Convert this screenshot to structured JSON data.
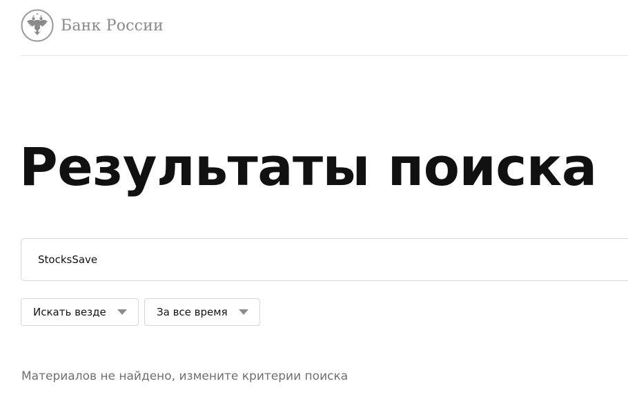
{
  "header": {
    "logo_text": "Банк России",
    "emblem_icon": "double-headed-eagle-icon"
  },
  "main": {
    "title": "Результаты поиска",
    "search": {
      "value": "StocksSave",
      "placeholder": ""
    },
    "filters": {
      "scope": {
        "selected": "Искать везде",
        "icon": "chevron-down-icon"
      },
      "period": {
        "selected": "За все время",
        "icon": "chevron-down-icon"
      }
    },
    "empty_message": "Материалов не найдено, измените критерии поиска"
  },
  "colors": {
    "logo_gray": "#8a8a8a",
    "title": "#111111",
    "border": "#d6d6d6",
    "muted_text": "#6f6f6f",
    "chevron": "#8c8c8c"
  }
}
